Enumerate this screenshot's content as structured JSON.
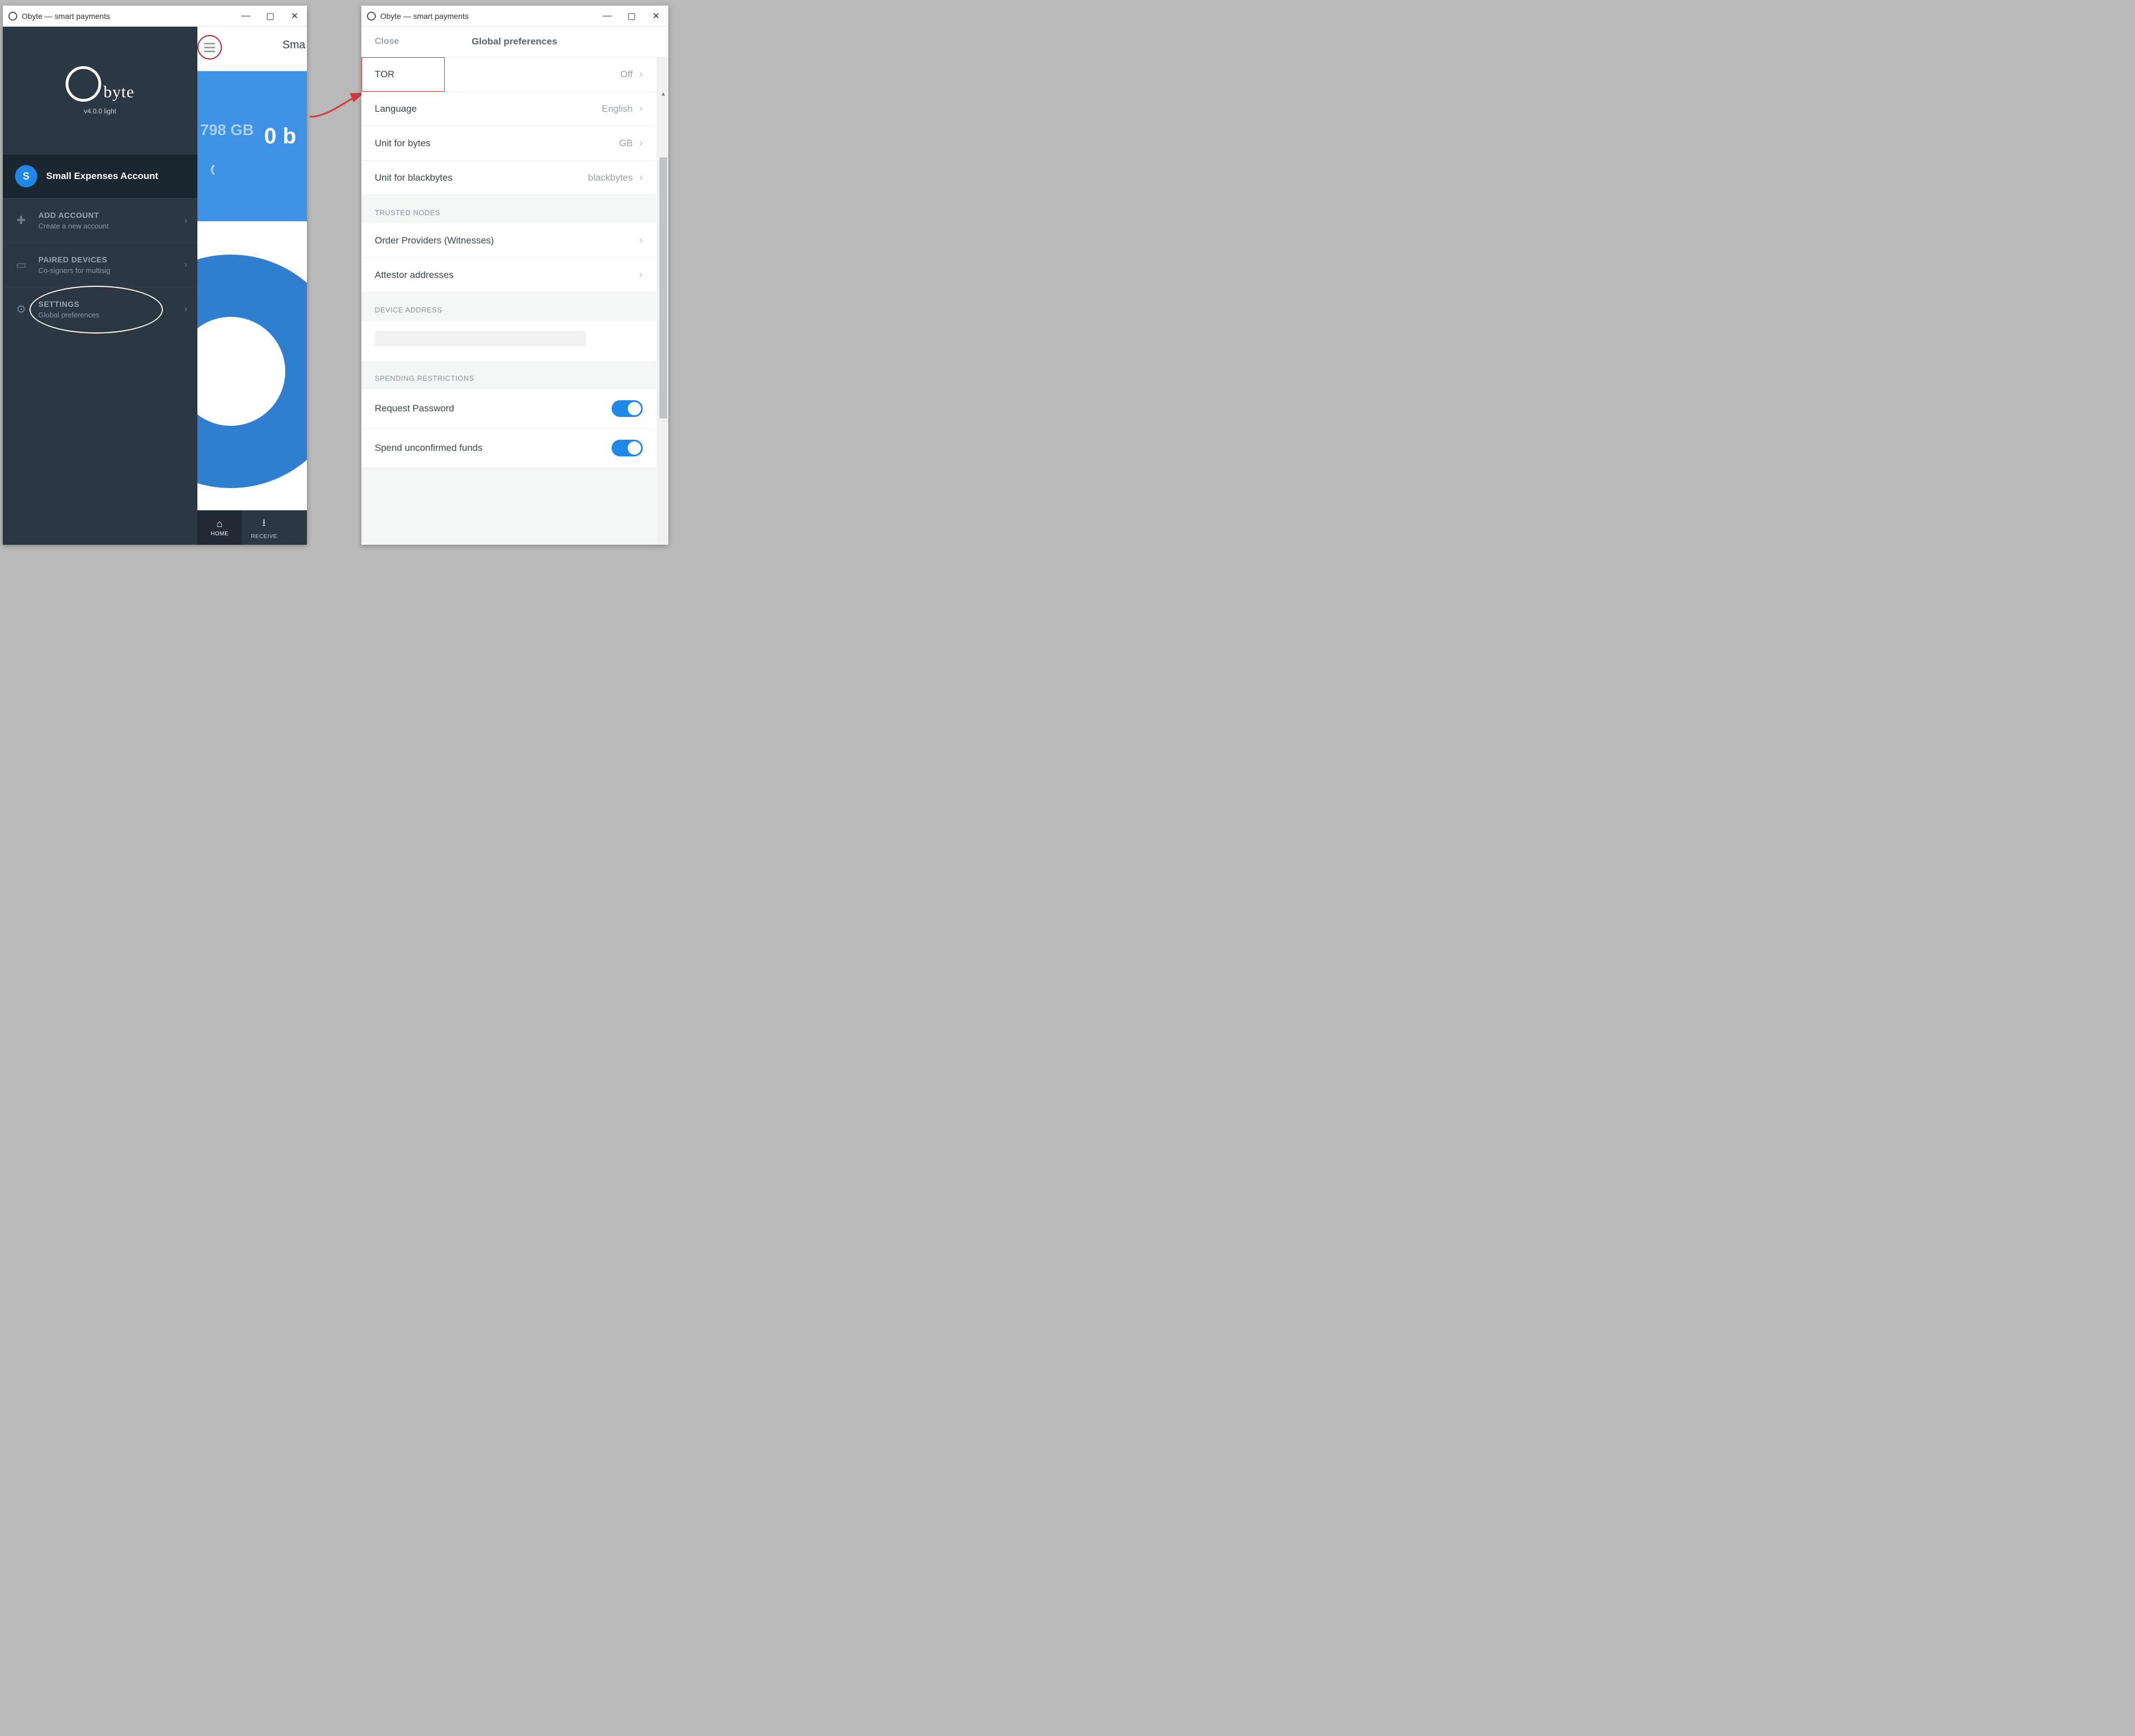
{
  "left_window": {
    "title": "Obyte — smart payments",
    "logo_text": "byte",
    "version": "v4.0.0 light",
    "account": {
      "initial": "S",
      "name": "Small Expenses Account"
    },
    "menu": {
      "add_account": {
        "title": "ADD ACCOUNT",
        "sub": "Create a new account"
      },
      "paired": {
        "title": "PAIRED DEVICES",
        "sub": "Co-signers for multisig"
      },
      "settings": {
        "title": "SETTINGS",
        "sub": "Global preferences"
      }
    },
    "main_peek": {
      "sma": "Sma",
      "gb": "798 GB",
      "zero_b": "0 b"
    },
    "tabs": {
      "home": "HOME",
      "receive": "RECEIVE"
    }
  },
  "right_window": {
    "title": "Obyte — smart payments",
    "close": "Close",
    "header": "Global preferences",
    "rows": {
      "tor": {
        "label": "TOR",
        "value": "Off"
      },
      "language": {
        "label": "Language",
        "value": "English"
      },
      "unit_bytes": {
        "label": "Unit for bytes",
        "value": "GB"
      },
      "unit_black": {
        "label": "Unit for blackbytes",
        "value": "blackbytes"
      }
    },
    "sections": {
      "trusted": "TRUSTED NODES",
      "order_providers": "Order Providers (Witnesses)",
      "attestor": "Attestor addresses",
      "device_addr": "DEVICE ADDRESS",
      "spending": "SPENDING RESTRICTIONS",
      "req_pass": "Request Password",
      "spend_unconf": "Spend unconfirmed funds"
    }
  }
}
